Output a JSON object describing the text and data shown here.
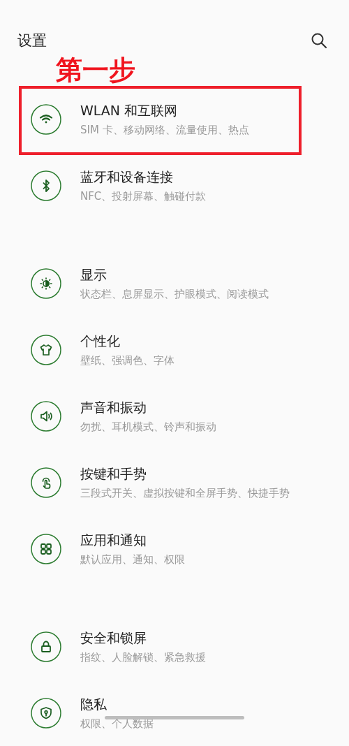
{
  "header": {
    "title": "设置"
  },
  "annotation": {
    "text": "第一步"
  },
  "groups": [
    {
      "items": [
        {
          "kind": "wifi",
          "title": "WLAN 和互联网",
          "subtitle": "SIM 卡、移动网络、流量使用、热点",
          "highlighted": true
        },
        {
          "kind": "bluetooth",
          "title": "蓝牙和设备连接",
          "subtitle": "NFC、投射屏幕、触碰付款",
          "highlighted": false
        }
      ]
    },
    {
      "items": [
        {
          "kind": "brightness",
          "title": "显示",
          "subtitle": "状态栏、息屏显示、护眼模式、阅读模式",
          "highlighted": false
        },
        {
          "kind": "shirt",
          "title": "个性化",
          "subtitle": "壁纸、强调色、字体",
          "highlighted": false
        },
        {
          "kind": "speaker",
          "title": "声音和振动",
          "subtitle": "勿扰、耳机模式、铃声和振动",
          "highlighted": false
        },
        {
          "kind": "gesture",
          "title": "按键和手势",
          "subtitle": "三段式开关、虚拟按键和全屏手势、快捷手势",
          "highlighted": false
        },
        {
          "kind": "apps",
          "title": "应用和通知",
          "subtitle": "默认应用、通知、权限",
          "highlighted": false
        }
      ]
    },
    {
      "items": [
        {
          "kind": "lock",
          "title": "安全和锁屏",
          "subtitle": "指纹、人脸解锁、紧急救援",
          "highlighted": false
        },
        {
          "kind": "shield",
          "title": "隐私",
          "subtitle": "权限、个人数据",
          "highlighted": false
        }
      ]
    }
  ]
}
